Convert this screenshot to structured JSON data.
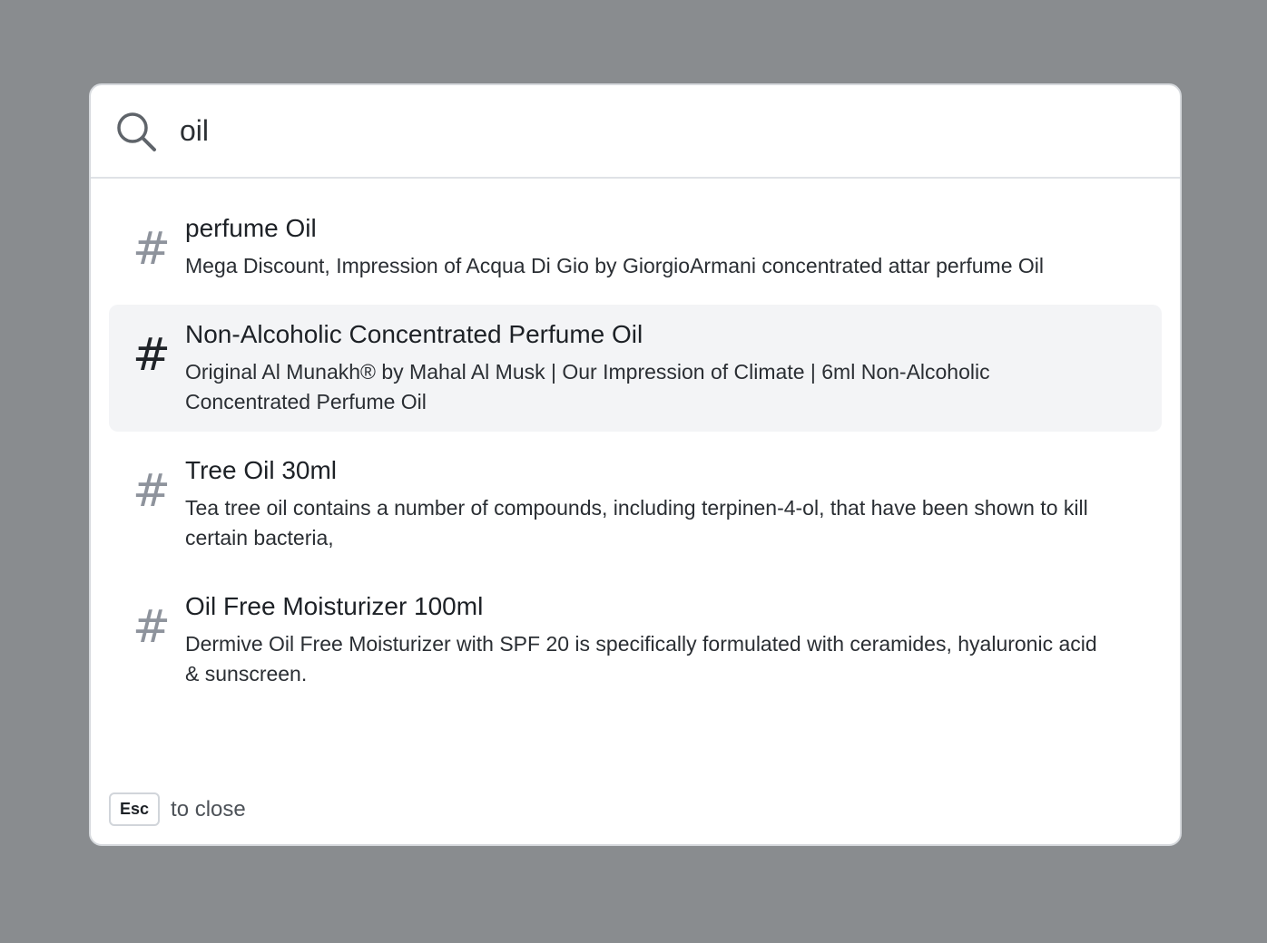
{
  "search": {
    "query": "oil",
    "icon": "search-icon"
  },
  "results": [
    {
      "icon": "hash-icon",
      "title": "perfume Oil",
      "description": "Mega Discount, Impression of Acqua Di Gio by GiorgioArmani concentrated attar perfume Oil",
      "active": false
    },
    {
      "icon": "hash-icon",
      "title": "Non-Alcoholic Concentrated Perfume Oil",
      "description": "Original Al Munakh® by Mahal Al Musk | Our Impression of Climate | 6ml Non-Alcoholic Concentrated Perfume Oil",
      "active": true
    },
    {
      "icon": "hash-icon",
      "title": "Tree Oil 30ml",
      "description": "Tea tree oil contains a number of compounds, including terpinen-4-ol, that have been shown to kill certain bacteria,",
      "active": false
    },
    {
      "icon": "hash-icon",
      "title": "Oil Free Moisturizer 100ml",
      "description": "Dermive Oil Free Moisturizer with SPF 20 is specifically formulated with ceramides, hyaluronic acid & sunscreen.",
      "active": false
    }
  ],
  "footer": {
    "key": "Esc",
    "text": "to close"
  },
  "colors": {
    "backdrop": "#898c8f",
    "active_row": "#f3f4f6",
    "hash_inactive": "#8e939c",
    "hash_active": "#1f2328"
  }
}
